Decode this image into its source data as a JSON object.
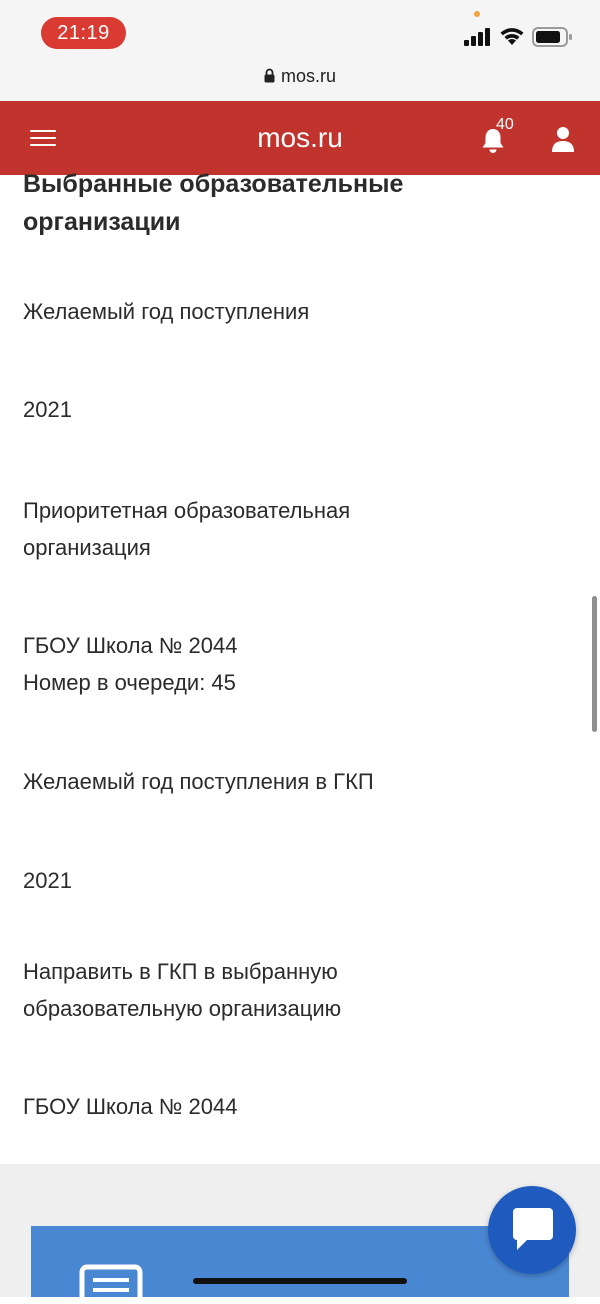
{
  "status_bar": {
    "time": "21:19",
    "icons": [
      "signal-icon",
      "wifi-icon",
      "battery-icon"
    ]
  },
  "browser": {
    "url": "mos.ru"
  },
  "header": {
    "title": "mos.ru",
    "notification_count": "40",
    "brand_color": "#c0342d"
  },
  "content": {
    "section_title": "Выбранные образовательные организации",
    "fields": [
      "Желаемый год поступления",
      "2021",
      "Приоритетная образовательная организация",
      "ГБОУ Школа № 2044\nНомер в очереди: 45",
      "Желаемый год поступления в ГКП",
      "2021",
      "Направить в ГКП в выбранную образовательную организацию",
      "ГБОУ Школа № 2044"
    ]
  },
  "footer": {
    "card_color": "#4a87d3",
    "chat_button_color": "#1f5bbf"
  }
}
